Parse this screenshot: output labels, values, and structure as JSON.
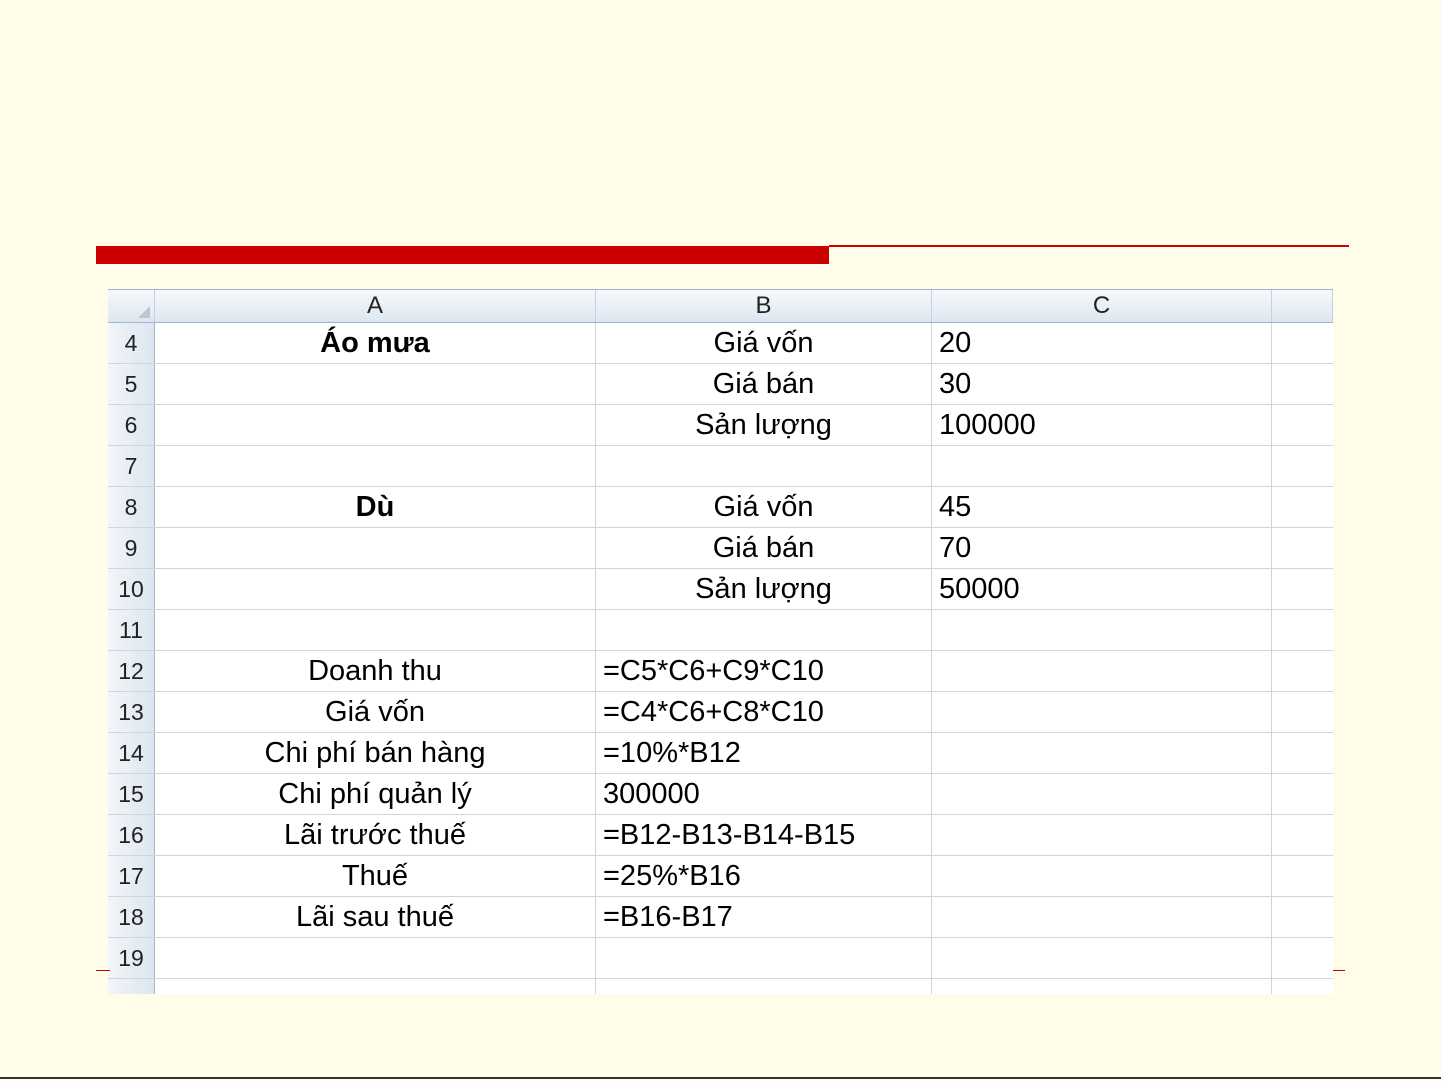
{
  "sheet": {
    "columns": [
      "A",
      "B",
      "C",
      ""
    ],
    "rows": [
      {
        "num": "4",
        "a": "Áo mưa",
        "b": "Giá vốn",
        "c": "20"
      },
      {
        "num": "5",
        "a": "",
        "b": "Giá bán",
        "c": "30"
      },
      {
        "num": "6",
        "a": "",
        "b": "Sản lượng",
        "c": "100000"
      },
      {
        "num": "7",
        "a": "",
        "b": "",
        "c": ""
      },
      {
        "num": "8",
        "a": "Dù",
        "b": "Giá vốn",
        "c": "45"
      },
      {
        "num": "9",
        "a": "",
        "b": "Giá bán",
        "c": "70"
      },
      {
        "num": "10",
        "a": "",
        "b": "Sản lượng",
        "c": "50000"
      },
      {
        "num": "11",
        "a": "",
        "b": "",
        "c": ""
      },
      {
        "num": "12",
        "a": "Doanh thu",
        "b": "=C5*C6+C9*C10",
        "c": ""
      },
      {
        "num": "13",
        "a": "Giá vốn",
        "b": "=C4*C6+C8*C10",
        "c": ""
      },
      {
        "num": "14",
        "a": "Chi phí bán hàng",
        "b": "=10%*B12",
        "c": ""
      },
      {
        "num": "15",
        "a": "Chi phí quản lý",
        "b": "300000",
        "c": ""
      },
      {
        "num": "16",
        "a": "Lãi trước thuế",
        "b": "=B12-B13-B14-B15",
        "c": ""
      },
      {
        "num": "17",
        "a": "Thuế",
        "b": "=25%*B16",
        "c": ""
      },
      {
        "num": "18",
        "a": "Lãi sau thuế",
        "b": "=B16-B17",
        "c": ""
      },
      {
        "num": "19",
        "a": "",
        "b": "",
        "c": ""
      },
      {
        "num": "",
        "a": "",
        "b": "",
        "c": ""
      }
    ]
  },
  "colors": {
    "slide_background": "#fffdea",
    "accent_bar": "#cc0000"
  }
}
